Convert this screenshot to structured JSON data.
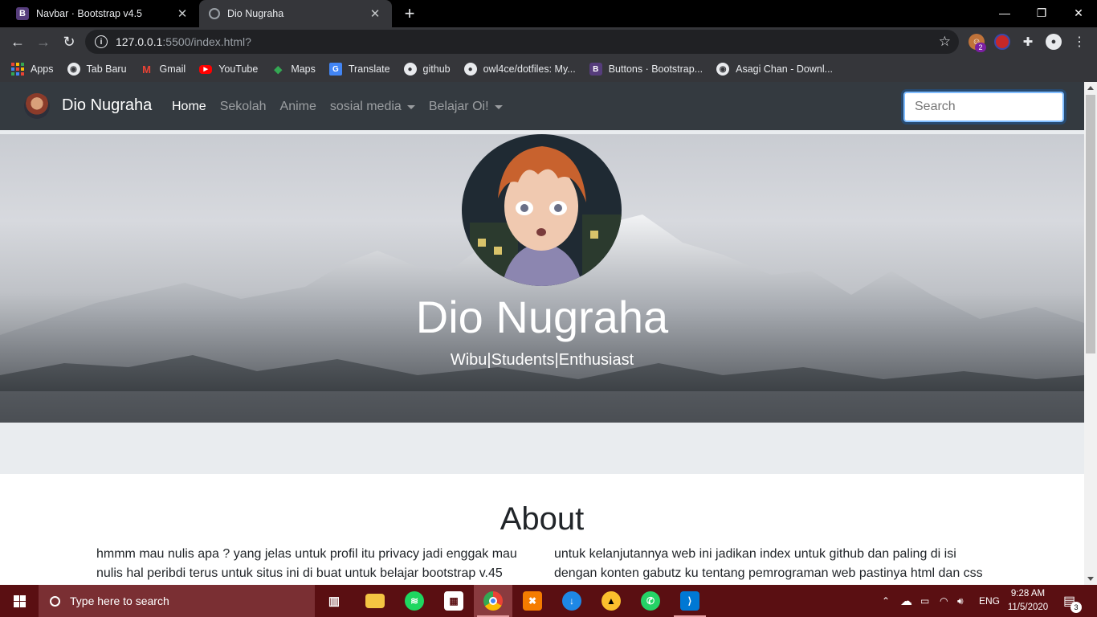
{
  "browser": {
    "tabs": [
      {
        "title": "Navbar · Bootstrap v4.5",
        "favicon": "bootstrap-icon",
        "active": false
      },
      {
        "title": "Dio Nugraha",
        "favicon": "globe-icon",
        "active": true
      }
    ],
    "address": {
      "host": "127.0.0.1",
      "rest": ":5500/index.html?"
    },
    "extension_badge": "2"
  },
  "bookmarks": [
    {
      "label": "Apps",
      "icon": "apps-grid-icon"
    },
    {
      "label": "Tab Baru",
      "icon": "globe-icon"
    },
    {
      "label": "Gmail",
      "icon": "gmail-icon"
    },
    {
      "label": "YouTube",
      "icon": "youtube-icon"
    },
    {
      "label": "Maps",
      "icon": "maps-icon"
    },
    {
      "label": "Translate",
      "icon": "translate-icon"
    },
    {
      "label": "github",
      "icon": "github-icon"
    },
    {
      "label": "owl4ce/dotfiles: My...",
      "icon": "github-icon"
    },
    {
      "label": "Buttons · Bootstrap...",
      "icon": "bootstrap-icon"
    },
    {
      "label": "Asagi Chan - Downl...",
      "icon": "globe-icon"
    }
  ],
  "site": {
    "brand": "Dio Nugraha",
    "nav": [
      {
        "label": "Home",
        "active": true,
        "dropdown": false
      },
      {
        "label": "Sekolah",
        "active": false,
        "dropdown": false
      },
      {
        "label": "Anime",
        "active": false,
        "dropdown": false
      },
      {
        "label": "sosial media",
        "active": false,
        "dropdown": true
      },
      {
        "label": "Belajar Oi!",
        "active": false,
        "dropdown": true
      }
    ],
    "search_placeholder": "Search",
    "hero": {
      "name": "Dio Nugraha",
      "tagline": "Wibu|Students|Enthusiast"
    },
    "about": {
      "title": "About",
      "left": "hmmm mau nulis apa ? yang jelas untuk profil itu privacy jadi enggak mau nulis hal peribdi terus untuk situs ini di buat untuk belajar bootstrap v.45",
      "right": "untuk kelanjutannya web ini jadikan index untuk github dan paling di isi dengan konten gabutz ku tentang pemrograman web pastinya html dan css"
    }
  },
  "taskbar": {
    "search_placeholder": "Type here to search",
    "language": "ENG",
    "time": "9:28 AM",
    "date": "11/5/2020",
    "notification_count": "3"
  },
  "colors": {
    "navbar": "#343a40",
    "taskbar": "#5a0f12",
    "jumbotron": "#e9ecef",
    "search_focus": "#80bdff"
  }
}
